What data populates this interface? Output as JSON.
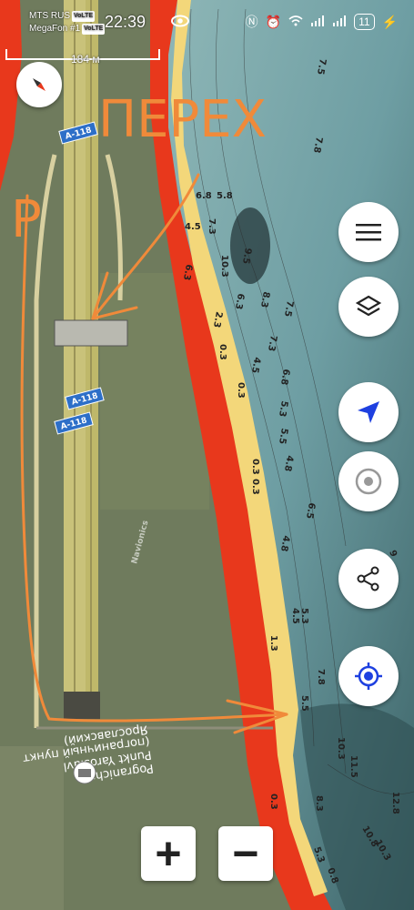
{
  "status_bar": {
    "carrier1": "MTS RUS",
    "carrier2": "MegaFon #1",
    "volte": "VoLTE",
    "time": "22:39",
    "battery": "11"
  },
  "map": {
    "scale_label": "184 м",
    "road_shields": [
      "A-118",
      "A-118",
      "A-118"
    ],
    "annotation_top": "ПЕРЕХ",
    "annotation_left": "Р",
    "place_name_line1": "Pogranichny",
    "place_name_line2": "Punkt Yaroslavl",
    "place_name_line3": "(пограничный пункт",
    "place_name_line4": "Ярославский)",
    "depths": [
      "7.5",
      "7.8",
      "6.8",
      "5.8",
      "7.3",
      "4.5",
      "10.3",
      "9.5",
      "6.3",
      "8.3",
      "6.3",
      "7.5",
      "2.3",
      "7.3",
      "4.5",
      "6.8",
      "0.3",
      "0.3",
      "5.3",
      "5.5",
      "4.8",
      "0.3",
      "0.3",
      "6.5",
      "4.8",
      "5.3",
      "4.5",
      "1.3",
      "7.8",
      "5.5",
      "10.3",
      "11.5",
      "8.3",
      "12.8",
      "0.3",
      "10.8",
      "10.3",
      "5.3",
      "0.8",
      "9"
    ],
    "watermark": "Navionics"
  },
  "buttons": {
    "zoom_in": "+",
    "zoom_out": "−"
  },
  "colors": {
    "shore_red": "#e8381c",
    "shallow_yellow": "#f3d77a",
    "water_teal": "#6e9ea3",
    "annotation_orange": "#f08a3a",
    "nav_blue": "#1e40e0"
  }
}
